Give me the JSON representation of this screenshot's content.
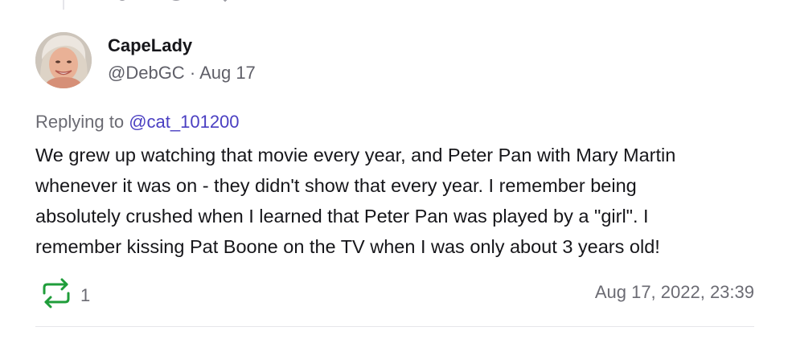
{
  "post": {
    "display_name": "CapeLady",
    "handle": "@DebGC",
    "separator": "·",
    "date_short": "Aug 17",
    "replying_prefix": "Replying to",
    "replying_to": "@cat_101200",
    "body_lines": [
      "We grew up watching that movie every year, and Peter Pan with Mary Martin",
      "whenever it was on - they didn't show that every year.  I remember being",
      "absolutely crushed when I learned that Peter Pan was played by a \"girl\".  I",
      "remember kissing Pat Boone on the TV when I was only about 3 years old!"
    ],
    "repost_icon": "repost-icon",
    "repost_count": "1",
    "timestamp": "Aug 17, 2022, 23:39"
  },
  "colors": {
    "accent_green": "#1f9d3a",
    "mention": "#4a3fc2",
    "muted_text": "#6b6b73"
  }
}
